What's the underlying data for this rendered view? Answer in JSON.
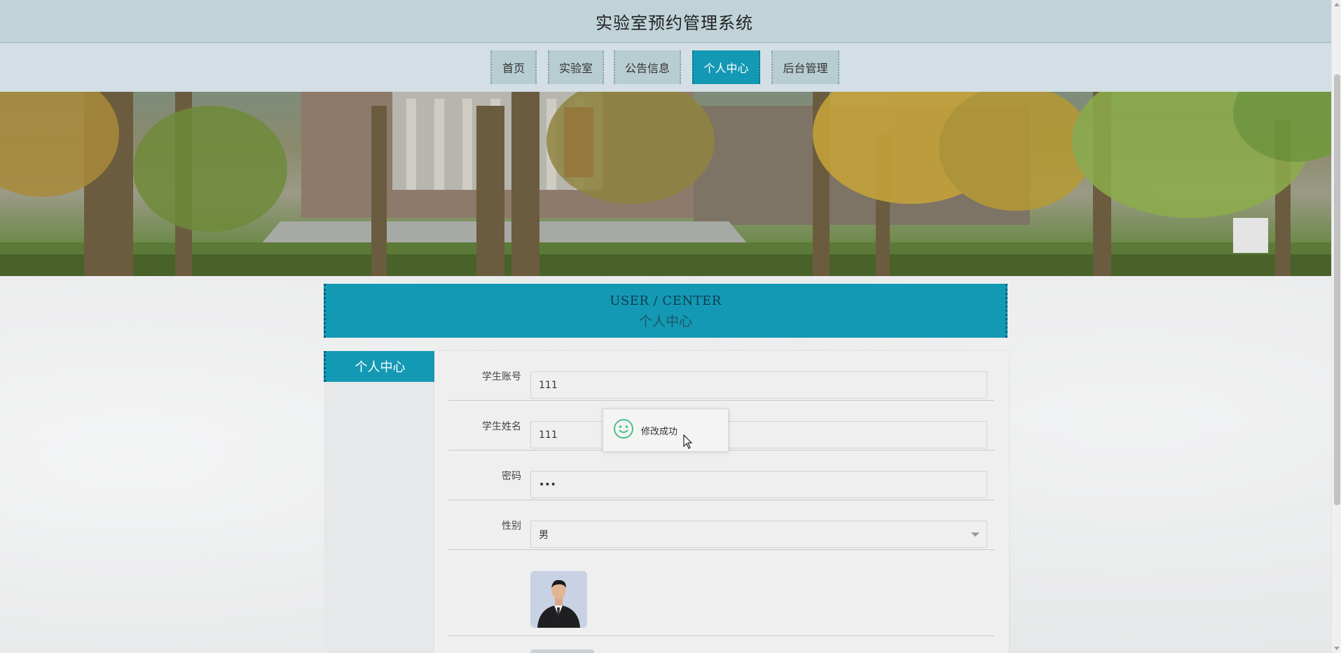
{
  "header": {
    "title": "实验室预约管理系统"
  },
  "nav": {
    "items": [
      {
        "label": "首页",
        "active": false
      },
      {
        "label": "实验室",
        "active": false
      },
      {
        "label": "公告信息",
        "active": false
      },
      {
        "label": "个人中心",
        "active": true
      },
      {
        "label": "后台管理",
        "active": false
      }
    ]
  },
  "section": {
    "title_en": "USER / CENTER",
    "title_zh": "个人中心"
  },
  "side_menu": {
    "items": [
      {
        "label": "个人中心",
        "active": true
      }
    ]
  },
  "form": {
    "fields": [
      {
        "label": "学生账号",
        "value": "111",
        "type": "text"
      },
      {
        "label": "学生姓名",
        "value": "111",
        "type": "text"
      },
      {
        "label": "密码",
        "value": "•••",
        "type": "password"
      },
      {
        "label": "性别",
        "value": "男",
        "type": "select"
      }
    ],
    "avatar": "student-photo"
  },
  "toast": {
    "message": "修改成功",
    "icon": "smiley-icon"
  },
  "colors": {
    "accent": "#1499b5",
    "header_bg": "#bfd3d8",
    "nav_bg": "#d3dfe5",
    "nav_item_bg": "#b8cdd2"
  }
}
